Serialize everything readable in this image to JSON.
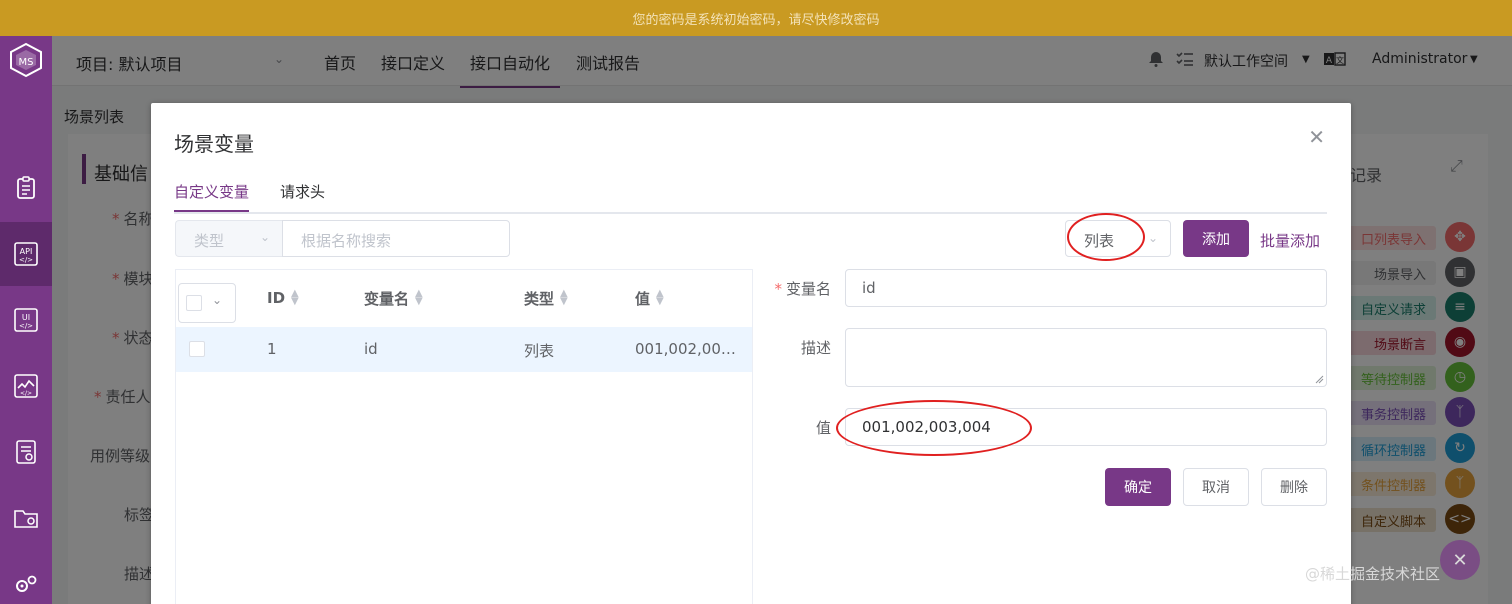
{
  "banner": "您的密码是系统初始密码，请尽快修改密码",
  "header": {
    "project": "项目: 默认项目",
    "nav": [
      "首页",
      "接口定义",
      "接口自动化",
      "测试报告"
    ],
    "workspace": "默认工作空间",
    "lang_icon": "translate-icon",
    "user": "Administrator"
  },
  "background": {
    "breadcrumb": "场景列表",
    "section": "基础信",
    "labels": [
      "名称",
      "模块",
      "状态",
      "责任人",
      "用例等级",
      "标签",
      "描述"
    ],
    "record": "记录",
    "palette": [
      {
        "label": "口列表导入",
        "color": "#f56c6c",
        "bg": "#fde2e2"
      },
      {
        "label": "场景导入",
        "color": "#606266",
        "bg": "#f0f0f0"
      },
      {
        "label": "自定义请求",
        "color": "#1a7f6d",
        "bg": "#d6f2ec"
      },
      {
        "label": "场景断言",
        "color": "#a3152b",
        "bg": "#f8d7dc"
      },
      {
        "label": "等待控制器",
        "color": "#67c23a",
        "bg": "#e1f3d8"
      },
      {
        "label": "事务控制器",
        "color": "#7b4fb8",
        "bg": "#ebe0f7"
      },
      {
        "label": "循环控制器",
        "color": "#1e9fd8",
        "bg": "#d6eefa"
      },
      {
        "label": "条件控制器",
        "color": "#e6a23c",
        "bg": "#faecd8"
      },
      {
        "label": "自定义脚本",
        "color": "#7a4a12",
        "bg": "#efe2cf"
      }
    ]
  },
  "modal": {
    "title": "场景变量",
    "tabs": [
      "自定义变量",
      "请求头"
    ],
    "type_placeholder": "类型",
    "search_placeholder": "根据名称搜索",
    "view_mode": "列表",
    "add_label": "添加",
    "batch_add_label": "批量添加",
    "table": {
      "columns": [
        "ID",
        "变量名",
        "类型",
        "值"
      ],
      "rows": [
        {
          "id": "1",
          "name": "id",
          "type": "列表",
          "value": "001,002,00…"
        }
      ]
    },
    "form": {
      "name_label": "变量名",
      "name_value": "id",
      "desc_label": "描述",
      "desc_value": "",
      "value_label": "值",
      "value_value": "001,002,003,004",
      "confirm": "确定",
      "cancel": "取消",
      "delete": "删除"
    }
  },
  "watermark": "@稀土掘金技术社区"
}
